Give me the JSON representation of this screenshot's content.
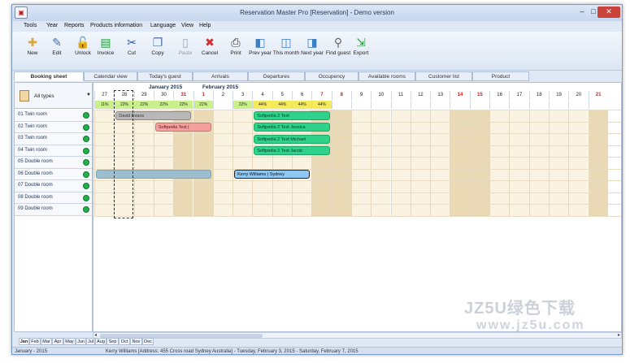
{
  "window": {
    "title": "Reservation Master Pro [Reservation] - Demo version",
    "min": "–",
    "max": "□",
    "close": "✕"
  },
  "menu": [
    "Tools",
    "Year",
    "Reports",
    "Products information",
    "Language",
    "View",
    "Help"
  ],
  "toolbar": [
    {
      "label": "New",
      "icon": "new-icon",
      "glyph": "✚",
      "color": "#d6a640",
      "disabled": false
    },
    {
      "label": "Edit",
      "icon": "edit-icon",
      "glyph": "✎",
      "color": "#3d6fb5",
      "disabled": false
    },
    {
      "label": "Unlock",
      "icon": "unlock-icon",
      "glyph": "🔓",
      "color": "#c99a20",
      "disabled": false
    },
    {
      "label": "Invoice",
      "icon": "invoice-icon",
      "glyph": "▤",
      "color": "#2f9a45",
      "disabled": false
    },
    {
      "label": "Cut",
      "icon": "cut-icon",
      "glyph": "✂",
      "color": "#2c5aa0",
      "disabled": false
    },
    {
      "label": "Copy",
      "icon": "copy-icon",
      "glyph": "❐",
      "color": "#4a6fa5",
      "disabled": false
    },
    {
      "label": "Paste",
      "icon": "paste-icon",
      "glyph": "▯",
      "color": "#9aa7b8",
      "disabled": true
    },
    {
      "label": "Cancel",
      "icon": "cancel-icon",
      "glyph": "✖",
      "color": "#d03030",
      "disabled": false
    },
    {
      "label": "Print",
      "icon": "print-icon",
      "glyph": "⎙",
      "color": "#333",
      "disabled": false
    },
    {
      "label": "Prev year",
      "icon": "prev-year-icon",
      "glyph": "◧",
      "color": "#3b7fc4",
      "disabled": false
    },
    {
      "label": "This month",
      "icon": "this-month-icon",
      "glyph": "◫",
      "color": "#3b7fc4",
      "disabled": false
    },
    {
      "label": "Next year",
      "icon": "next-year-icon",
      "glyph": "◨",
      "color": "#3b7fc4",
      "disabled": false
    },
    {
      "label": "Find guest",
      "icon": "find-guest-icon",
      "glyph": "⚲",
      "color": "#666",
      "disabled": false
    },
    {
      "label": "Export",
      "icon": "export-icon",
      "glyph": "⇲",
      "color": "#2f9a45",
      "disabled": false
    }
  ],
  "tabs": [
    "Booking sheet",
    "Calendar view",
    "Today's guest",
    "Arrivals",
    "Departures",
    "Occupency",
    "Available rooms",
    "Customer list",
    "Product"
  ],
  "left": {
    "filter_label": "All types",
    "rooms": [
      "01 Twin room",
      "02 Twin room",
      "03 Twin room",
      "04 Twin room",
      "05 Double room",
      "06 Double room",
      "07 Double room",
      "08 Double room",
      "09 Double room"
    ]
  },
  "grid": {
    "months": [
      "January 2015",
      "February 2015"
    ],
    "days": [
      "27",
      "28",
      "29",
      "30",
      "31",
      "1",
      "2",
      "3",
      "4",
      "5",
      "6",
      "7",
      "8",
      "9",
      "10",
      "11",
      "12",
      "13",
      "14",
      "15",
      "16",
      "17",
      "18",
      "19",
      "20",
      "21"
    ],
    "weekend_days": [
      "31",
      "1",
      "7",
      "8",
      "14",
      "15",
      "21"
    ],
    "occupancy": [
      "11%",
      "22%",
      "22%",
      "22%",
      "22%",
      "22%",
      "",
      "22%",
      "44%",
      "44%",
      "44%",
      "44%"
    ],
    "occupancy_colors": {
      "low": "#c9f08a",
      "high": "#f5ea5a"
    }
  },
  "bookings": [
    {
      "text": "David Evans",
      "room": 0,
      "start": 1,
      "span": 4,
      "color": "gray"
    },
    {
      "text": "Softpedia 2 Test",
      "room": 0,
      "start": 8,
      "span": 4,
      "color": "green"
    },
    {
      "text": "Softpedia Test |",
      "room": 1,
      "start": 3,
      "span": 3,
      "color": "red"
    },
    {
      "text": "Softpedia 2 Test Jessica",
      "room": 1,
      "start": 8,
      "span": 4,
      "color": "green"
    },
    {
      "text": "Softpedia 2 Test Michael",
      "room": 2,
      "start": 8,
      "span": 4,
      "color": "green"
    },
    {
      "text": "Softpedia 2 Test Jacob",
      "room": 3,
      "start": 8,
      "span": 4,
      "color": "green"
    },
    {
      "text": "",
      "room": 5,
      "start": 0,
      "span": 6,
      "color": "teal"
    },
    {
      "text": "Kerry Williams | Sydney",
      "room": 5,
      "start": 7,
      "span": 4,
      "color": "blue"
    }
  ],
  "month_tabs": [
    "Jan",
    "Feb",
    "Mar",
    "Apr",
    "May",
    "Jun",
    "Jul",
    "Aug",
    "Sep",
    "Oct",
    "Nov",
    "Dec"
  ],
  "status": {
    "left": "January - 2015",
    "main": "Kerry Williams [Address: 455 Cross road Sydney Australia] - Tuesday, February 3, 2015 - Saturday, February 7, 2015"
  },
  "watermark": {
    "line1": "JZ5U绿色下载",
    "line2": "www.jz5u.com"
  }
}
